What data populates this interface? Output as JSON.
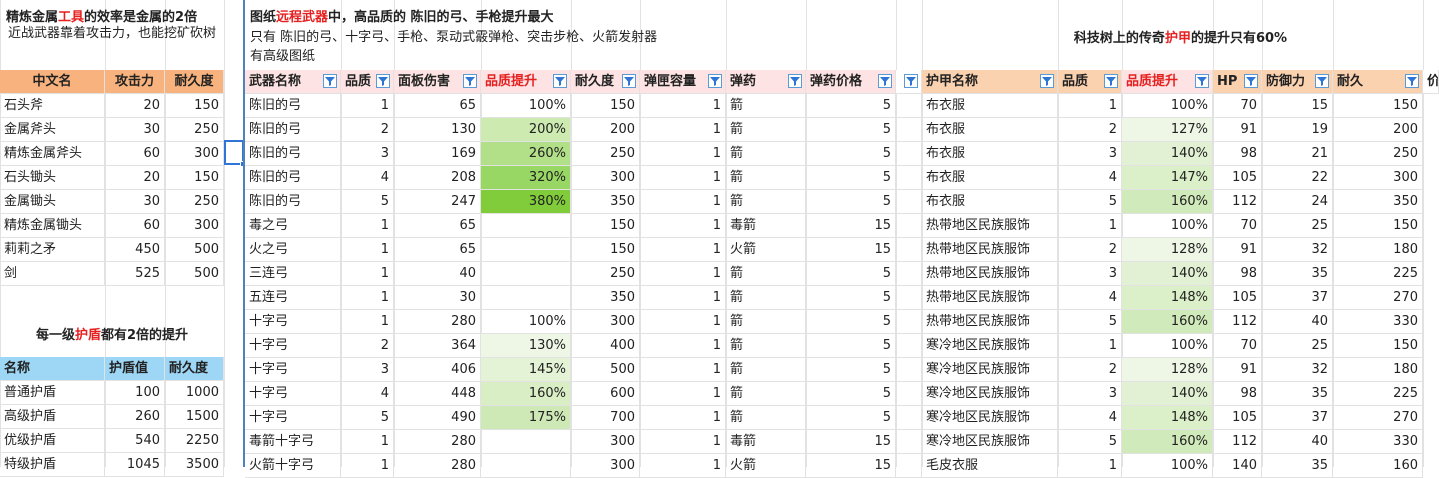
{
  "tools": {
    "title_pre": "精炼金属",
    "title_red": "工具",
    "title_post": "的效率是金属的2倍",
    "subtitle": "近战武器靠着攻击力，也能挖矿砍树",
    "headers": [
      "中文名",
      "攻击力",
      "耐久度"
    ],
    "rows": [
      [
        "石头斧",
        "20",
        "150"
      ],
      [
        "金属斧头",
        "30",
        "250"
      ],
      [
        "精炼金属斧头",
        "60",
        "300"
      ],
      [
        "石头锄头",
        "20",
        "150"
      ],
      [
        "金属锄头",
        "30",
        "250"
      ],
      [
        "精炼金属锄头",
        "60",
        "300"
      ],
      [
        "莉莉之矛",
        "450",
        "500"
      ],
      [
        "剑",
        "525",
        "500"
      ]
    ]
  },
  "shields": {
    "title_pre": "每一级",
    "title_red": "护盾",
    "title_post": "都有2倍的提升",
    "headers": [
      "名称",
      "护盾值",
      "耐久度"
    ],
    "rows": [
      [
        "普通护盾",
        "100",
        "1000"
      ],
      [
        "高级护盾",
        "260",
        "1500"
      ],
      [
        "优级护盾",
        "540",
        "2250"
      ],
      [
        "特级护盾",
        "1045",
        "3500"
      ]
    ]
  },
  "weapons": {
    "title_pre": "图纸",
    "title_red": "远程武器",
    "title_post": "中，高品质的 陈旧的弓、手枪提升最大",
    "note1": "只有 陈旧的弓、十字弓、手枪、泵动式霰弹枪、突击步枪、火箭发射器",
    "note2": "有高级图纸",
    "headers": [
      "武器名称",
      "品质",
      "面板伤害",
      "品质提升",
      "耐久度",
      "弹匣容量",
      "弹药",
      "弹药价格",
      ""
    ],
    "rows": [
      [
        "陈旧的弓",
        "1",
        "65",
        "100%",
        "150",
        "1",
        "箭",
        "5"
      ],
      [
        "陈旧的弓",
        "2",
        "130",
        "200%",
        "200",
        "1",
        "箭",
        "5"
      ],
      [
        "陈旧的弓",
        "3",
        "169",
        "260%",
        "250",
        "1",
        "箭",
        "5"
      ],
      [
        "陈旧的弓",
        "4",
        "208",
        "320%",
        "300",
        "1",
        "箭",
        "5"
      ],
      [
        "陈旧的弓",
        "5",
        "247",
        "380%",
        "350",
        "1",
        "箭",
        "5"
      ],
      [
        "毒之弓",
        "1",
        "65",
        "",
        "150",
        "1",
        "毒箭",
        "15"
      ],
      [
        "火之弓",
        "1",
        "65",
        "",
        "150",
        "1",
        "火箭",
        "15"
      ],
      [
        "三连弓",
        "1",
        "40",
        "",
        "250",
        "1",
        "箭",
        "5"
      ],
      [
        "五连弓",
        "1",
        "30",
        "",
        "350",
        "1",
        "箭",
        "5"
      ],
      [
        "十字弓",
        "1",
        "280",
        "100%",
        "300",
        "1",
        "箭",
        "5"
      ],
      [
        "十字弓",
        "2",
        "364",
        "130%",
        "400",
        "1",
        "箭",
        "5"
      ],
      [
        "十字弓",
        "3",
        "406",
        "145%",
        "500",
        "1",
        "箭",
        "5"
      ],
      [
        "十字弓",
        "4",
        "448",
        "160%",
        "600",
        "1",
        "箭",
        "5"
      ],
      [
        "十字弓",
        "5",
        "490",
        "175%",
        "700",
        "1",
        "箭",
        "5"
      ],
      [
        "毒箭十字弓",
        "1",
        "280",
        "",
        "300",
        "1",
        "毒箭",
        "15"
      ],
      [
        "火箭十字弓",
        "1",
        "280",
        "",
        "300",
        "1",
        "火箭",
        "15"
      ]
    ],
    "boost_colors": [
      "",
      "#cdeab0",
      "#b2e088",
      "#98d764",
      "#80cc3a",
      "",
      "",
      "",
      "",
      "",
      "#eef7e6",
      "#e4f3d6",
      "#d9eec5",
      "#cfe9b6",
      "",
      ""
    ]
  },
  "armor": {
    "title_pre": "科技树上的传奇",
    "title_red": "护甲",
    "title_post": "的提升只有60%",
    "headers": [
      "护甲名称",
      "品质",
      "品质提升",
      "HP",
      "防御力",
      "耐久",
      "价"
    ],
    "rows": [
      [
        "布衣服",
        "1",
        "100%",
        "70",
        "15",
        "150"
      ],
      [
        "布衣服",
        "2",
        "127%",
        "91",
        "19",
        "200"
      ],
      [
        "布衣服",
        "3",
        "140%",
        "98",
        "21",
        "250"
      ],
      [
        "布衣服",
        "4",
        "147%",
        "105",
        "22",
        "300"
      ],
      [
        "布衣服",
        "5",
        "160%",
        "112",
        "24",
        "350"
      ],
      [
        "热带地区民族服饰",
        "1",
        "100%",
        "70",
        "25",
        "150"
      ],
      [
        "热带地区民族服饰",
        "2",
        "128%",
        "91",
        "32",
        "180"
      ],
      [
        "热带地区民族服饰",
        "3",
        "140%",
        "98",
        "35",
        "225"
      ],
      [
        "热带地区民族服饰",
        "4",
        "148%",
        "105",
        "37",
        "270"
      ],
      [
        "热带地区民族服饰",
        "5",
        "160%",
        "112",
        "40",
        "330"
      ],
      [
        "寒冷地区民族服饰",
        "1",
        "100%",
        "70",
        "25",
        "150"
      ],
      [
        "寒冷地区民族服饰",
        "2",
        "128%",
        "91",
        "32",
        "180"
      ],
      [
        "寒冷地区民族服饰",
        "3",
        "140%",
        "98",
        "35",
        "225"
      ],
      [
        "寒冷地区民族服饰",
        "4",
        "148%",
        "105",
        "37",
        "270"
      ],
      [
        "寒冷地区民族服饰",
        "5",
        "160%",
        "112",
        "40",
        "330"
      ],
      [
        "毛皮衣服",
        "1",
        "100%",
        "140",
        "35",
        "160"
      ]
    ],
    "boost_colors": [
      "",
      "#eef7e6",
      "#e2f1d3",
      "#dbefc9",
      "#d1eabb",
      "",
      "#eef7e6",
      "#e2f1d3",
      "#dbefc9",
      "#d1eabb",
      "",
      "#eef7e6",
      "#e2f1d3",
      "#dbefc9",
      "#d1eabb",
      ""
    ]
  },
  "colors": {
    "header_orange": "#f7b27d",
    "header_blue": "#9dd7f5",
    "header_pink": "#fde3e3",
    "title_red": "#e62020",
    "filter_blue": "#2e75d6"
  }
}
